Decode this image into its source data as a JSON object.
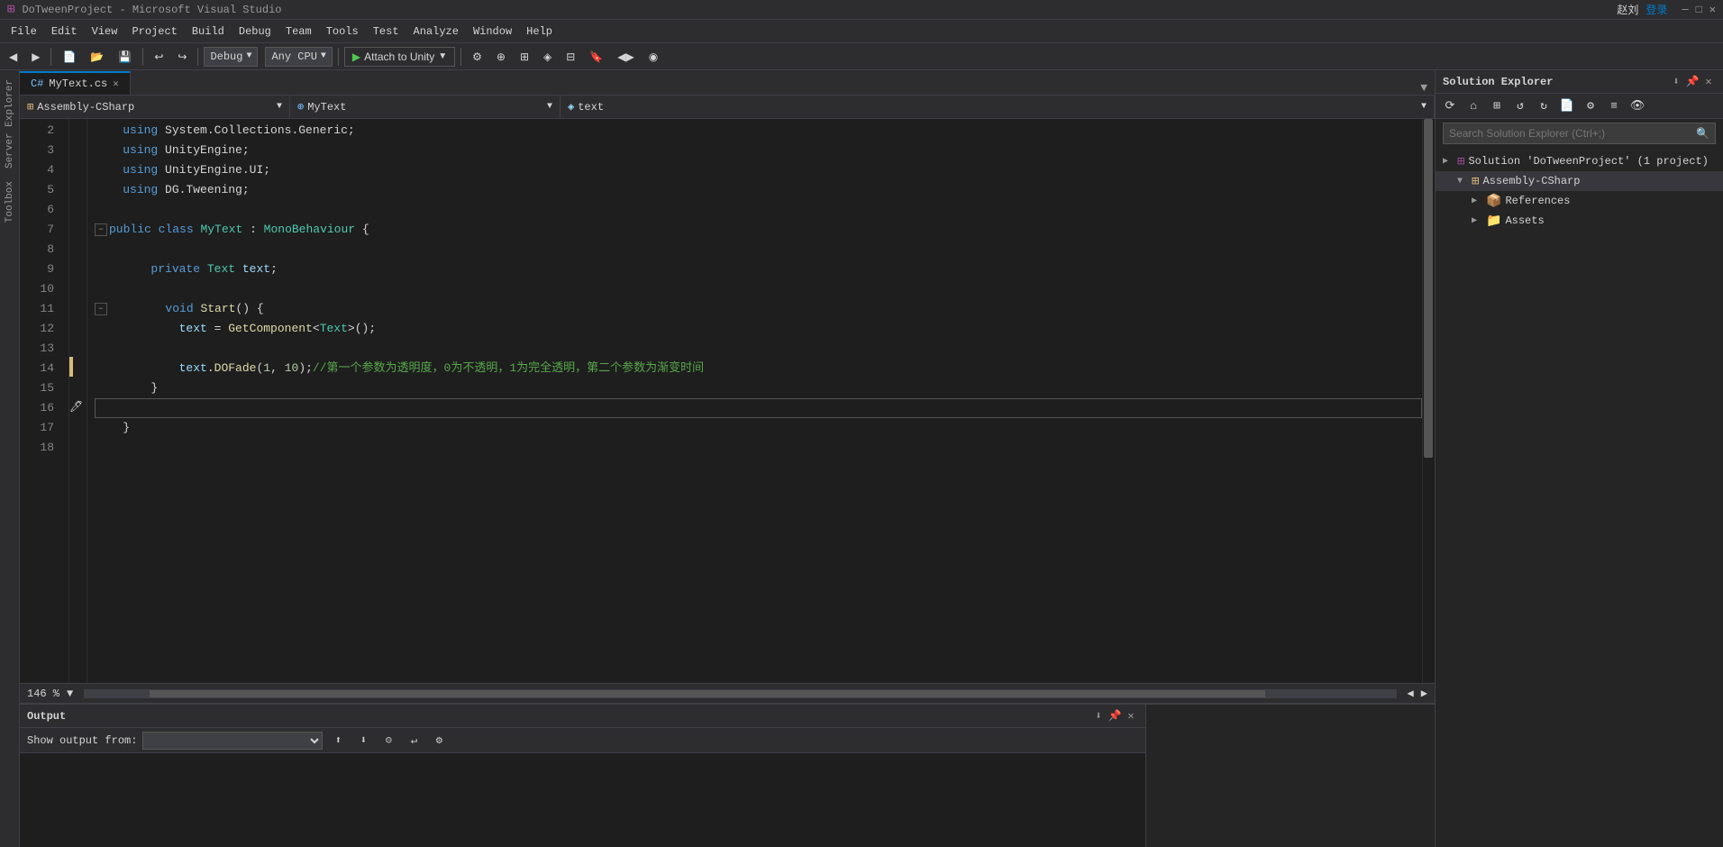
{
  "titlebar": {
    "title": "DoTweenProject - Microsoft Visual Studio",
    "icon": "vs-icon"
  },
  "menubar": {
    "items": [
      "File",
      "Edit",
      "View",
      "Project",
      "Build",
      "Debug",
      "Team",
      "Tools",
      "Test",
      "Analyze",
      "Window",
      "Help"
    ]
  },
  "toolbar": {
    "undo_btn": "↩",
    "redo_btn": "↪",
    "debug_config": "Debug",
    "platform": "Any CPU",
    "attach_label": "Attach to Unity",
    "zoom_level": "146 %"
  },
  "editor": {
    "tab_label": "MyText.cs",
    "nav_assembly": "Assembly-CSharp",
    "nav_class": "MyText",
    "nav_member": "text",
    "lines": [
      {
        "num": 2,
        "tokens": [
          {
            "t": "    using System.Collections.Generic;",
            "c": "plain"
          }
        ]
      },
      {
        "num": 3,
        "tokens": [
          {
            "t": "    using UnityEngine;",
            "c": "plain"
          }
        ]
      },
      {
        "num": 4,
        "tokens": [
          {
            "t": "    using UnityEngine.UI;",
            "c": "plain"
          }
        ]
      },
      {
        "num": 5,
        "tokens": [
          {
            "t": "    using DG.Tweening;",
            "c": "plain"
          }
        ]
      },
      {
        "num": 6,
        "tokens": [
          {
            "t": "",
            "c": "plain"
          }
        ]
      },
      {
        "num": 7,
        "tokens": [
          {
            "t": "    public class MyText : MonoBehaviour {",
            "c": "code"
          }
        ]
      },
      {
        "num": 8,
        "tokens": [
          {
            "t": "",
            "c": "plain"
          }
        ]
      },
      {
        "num": 9,
        "tokens": [
          {
            "t": "        private Text text;",
            "c": "code"
          }
        ]
      },
      {
        "num": 10,
        "tokens": [
          {
            "t": "",
            "c": "plain"
          }
        ]
      },
      {
        "num": 11,
        "tokens": [
          {
            "t": "        void Start() {",
            "c": "code"
          }
        ]
      },
      {
        "num": 12,
        "tokens": [
          {
            "t": "            text = GetComponent<Text>();",
            "c": "code"
          }
        ]
      },
      {
        "num": 13,
        "tokens": [
          {
            "t": "",
            "c": "plain"
          }
        ]
      },
      {
        "num": 14,
        "tokens": [
          {
            "t": "            text.DOFade(1, 10);//第一个参数为透明度，0为不透明，1为完全透明，第二个参数为渐变时间",
            "c": "code14"
          }
        ]
      },
      {
        "num": 15,
        "tokens": [
          {
            "t": "        }",
            "c": "plain"
          }
        ]
      },
      {
        "num": 16,
        "tokens": [
          {
            "t": "",
            "c": "plain"
          }
        ]
      },
      {
        "num": 17,
        "tokens": [
          {
            "t": "    }",
            "c": "plain"
          }
        ]
      },
      {
        "num": 18,
        "tokens": [
          {
            "t": "",
            "c": "plain"
          }
        ]
      }
    ]
  },
  "solution_explorer": {
    "title": "Solution Explorer",
    "search_placeholder": "Search Solution Explorer (Ctrl+;)",
    "tree": {
      "solution_label": "Solution 'DoTweenProject' (1 project)",
      "project_label": "Assembly-CSharp",
      "references_label": "References",
      "assets_label": "Assets"
    }
  },
  "output": {
    "title": "Output",
    "show_output_label": "Show output from:",
    "dropdown_value": ""
  },
  "user": {
    "name": "赵刘",
    "login_label": "登录"
  }
}
